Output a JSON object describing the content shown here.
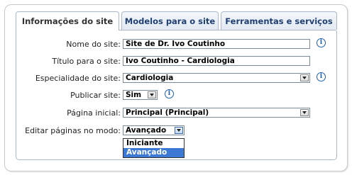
{
  "tabs": [
    {
      "label": "Informações do site"
    },
    {
      "label": "Modelos para o site"
    },
    {
      "label": "Ferramentas e serviços"
    }
  ],
  "form": {
    "site_name_label": "Nome do site:",
    "site_name_value": "Site de Dr. Ivo Coutinho",
    "site_title_label": "Título para o site:",
    "site_title_value": "Ivo Coutinho - Cardiologia",
    "specialty_label": "Especialidade do site:",
    "specialty_value": "Cardiologia",
    "publish_label": "Publicar site:",
    "publish_value": "Sim",
    "home_page_label": "Página inicial:",
    "home_page_value": "Principal (Principal)",
    "edit_mode_label": "Editar páginas no modo:",
    "edit_mode_value": "Avançado",
    "edit_mode_options": [
      "Iniciante",
      "Avançado"
    ]
  },
  "icons": {
    "info": "info-icon",
    "info_glyph": "i",
    "dropdown": "chevron-down-icon"
  },
  "colors": {
    "tab_text": "#1f3f72",
    "info": "#1d5fb3",
    "selection": "#3b79d5"
  }
}
